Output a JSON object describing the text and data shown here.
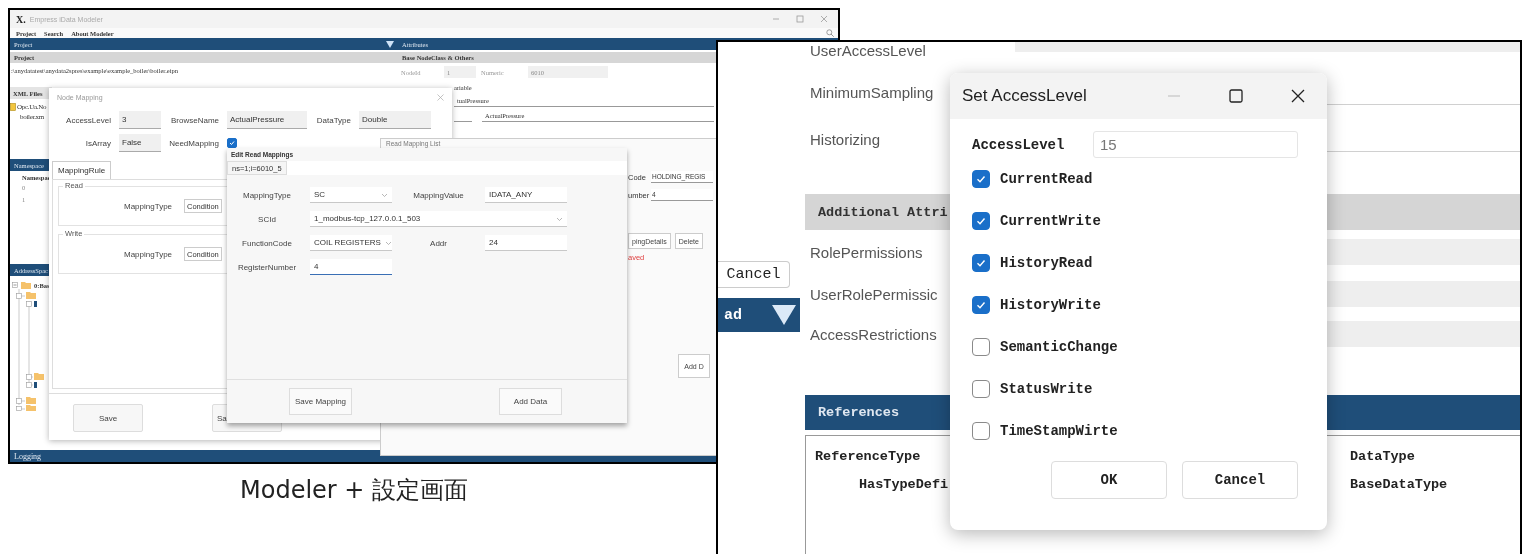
{
  "modeler": {
    "window": {
      "logo": "X.",
      "title": "Empress iData Modeler"
    },
    "menu": [
      "Project",
      "Search",
      "About Modeler"
    ],
    "project_panel": {
      "header": "Project",
      "section": "Project",
      "path": ":\\anydatatest\\anydata2spres\\example\\example_boiler\\boiler.eipn"
    },
    "xml_files": {
      "header": "XML Files",
      "items": [
        "Opc.Ua.No",
        "boiler.xm"
      ]
    },
    "namespace_array": {
      "header": "Namespace",
      "column": "Namespac",
      "rows": [
        "0",
        "1"
      ]
    },
    "address_space": {
      "header": "AddressSpac",
      "root": {
        "label": "0:Bas",
        "expanded": true
      }
    },
    "attributes": {
      "header": "Attributes",
      "section": "Base NodeClass & Others",
      "node_id_label": "NodeId",
      "node_id_ns": "1",
      "id_type": "Numeric",
      "node_id_value": "6010",
      "node_class": "ariable",
      "browse_name": "tualPressure",
      "display_name": "ActualPressure"
    },
    "node_mapping": {
      "title": "Node Mapping",
      "fields": [
        {
          "label": "AccessLevel",
          "value": "3"
        },
        {
          "label": "BrowseName",
          "value": "ActualPressure"
        },
        {
          "label": "DataType",
          "value": "Double"
        },
        {
          "label": "IsArray",
          "value": "False"
        }
      ],
      "need_mapping": {
        "label": "NeedMapping",
        "checked": true
      },
      "tabs": [
        {
          "label": "MappingRule",
          "selected": true
        }
      ],
      "groups": [
        {
          "legend": "Read",
          "label": "MappingType",
          "value": "Condition"
        },
        {
          "legend": "Write",
          "label": "MappingType",
          "value": "Condition"
        }
      ],
      "buttons": [
        "Save",
        "Sa"
      ]
    },
    "read_mapping_list": {
      "title": "Read Mapping List",
      "rows": [
        {
          "label": "Code",
          "value": "HOLDING_REGIS"
        },
        {
          "label": "umber",
          "value": "4"
        }
      ],
      "buttons": [
        "pingDetails",
        "Delete"
      ],
      "status": "aved",
      "add_button": "Add D"
    },
    "edit_read_mappings": {
      "title": "Edit Read Mappings",
      "node": "ns=1;i=6010_5",
      "rows": [
        [
          {
            "label": "MappingType",
            "value": "SC",
            "kind": "select",
            "focused": false
          },
          {
            "label": "MappingValue",
            "value": "IDATA_ANY",
            "kind": "text",
            "focused": false
          }
        ],
        [
          {
            "label": "SCId",
            "value": "1_modbus-tcp_127.0.0.1_503",
            "kind": "select",
            "focused": false
          }
        ],
        [
          {
            "label": "FunctionCode",
            "value": "COIL REGISTERS",
            "kind": "select",
            "focused": false
          },
          {
            "label": "Addr",
            "value": "24",
            "kind": "text",
            "focused": false
          }
        ],
        [
          {
            "label": "RegisterNumber",
            "value": "4",
            "kind": "text",
            "focused": true
          }
        ]
      ],
      "buttons": [
        "Save Mapping",
        "Add Data"
      ]
    },
    "status_bar": "Logging"
  },
  "access_level": {
    "side": {
      "cancel": "Cancel",
      "bar": "ad"
    },
    "attributes": [
      "UserAccessLevel",
      "MinimumSampling",
      "Historizing"
    ],
    "additional": {
      "header": "Additional Attri",
      "rows": [
        "RolePermissions",
        "UserRolePermissic",
        "AccessRestrictions"
      ]
    },
    "references": {
      "header": "References",
      "columns": [
        "ReferenceType",
        "DataType"
      ],
      "rows": [
        [
          "HasTypeDefi",
          "BaseDataType"
        ]
      ]
    },
    "dialog": {
      "title": "Set AccessLevel",
      "field_label": "AccessLevel",
      "field_value": "15",
      "flags": [
        {
          "label": "CurrentRead",
          "checked": true
        },
        {
          "label": "CurrentWrite",
          "checked": true
        },
        {
          "label": "HistoryRead",
          "checked": true
        },
        {
          "label": "HistoryWrite",
          "checked": true
        },
        {
          "label": "SemanticChange",
          "checked": false
        },
        {
          "label": "StatusWrite",
          "checked": false
        },
        {
          "label": "TimeStampWirte",
          "checked": false
        }
      ],
      "buttons": [
        "OK",
        "Cancel"
      ]
    }
  },
  "caption": "Modeler + 設定画面"
}
